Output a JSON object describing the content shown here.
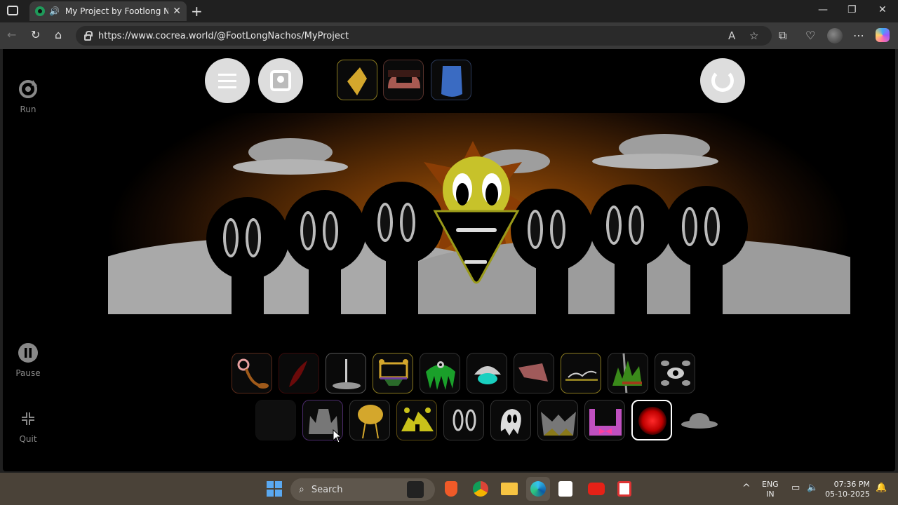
{
  "browser": {
    "tab_title": "My Project by Footlong Nachos",
    "url": "https://www.cocrea.world/@FootLongNachos/MyProject",
    "new_tab": "+",
    "close_tab": "✕",
    "minimize": "—",
    "maximize": "❐",
    "close_window": "✕"
  },
  "game": {
    "side": {
      "run_label": "Run",
      "pause_label": "Pause",
      "quit_label": "Quit"
    },
    "top_slots": [
      "gold-diamond",
      "red-figures",
      "blue-shield"
    ],
    "bottom_row1": [
      "hook-tool",
      "red-claw",
      "stand",
      "yellow-frame",
      "green-jellyfish",
      "cyan-dome",
      "red-block",
      "thin-lines",
      "green-spike",
      "eye-cluster"
    ],
    "bottom_row2": [
      "dark-square",
      "gray-helmet",
      "yellow-tree",
      "yellow-tent",
      "white-eyes",
      "ghost",
      "spiky-helmet",
      "pink-bow",
      "red-core",
      "gray-hat"
    ]
  },
  "taskbar": {
    "search_placeholder": "Search",
    "lang": "ENG",
    "region": "IN",
    "time": "07:36 PM",
    "date": "05-10-2025"
  }
}
